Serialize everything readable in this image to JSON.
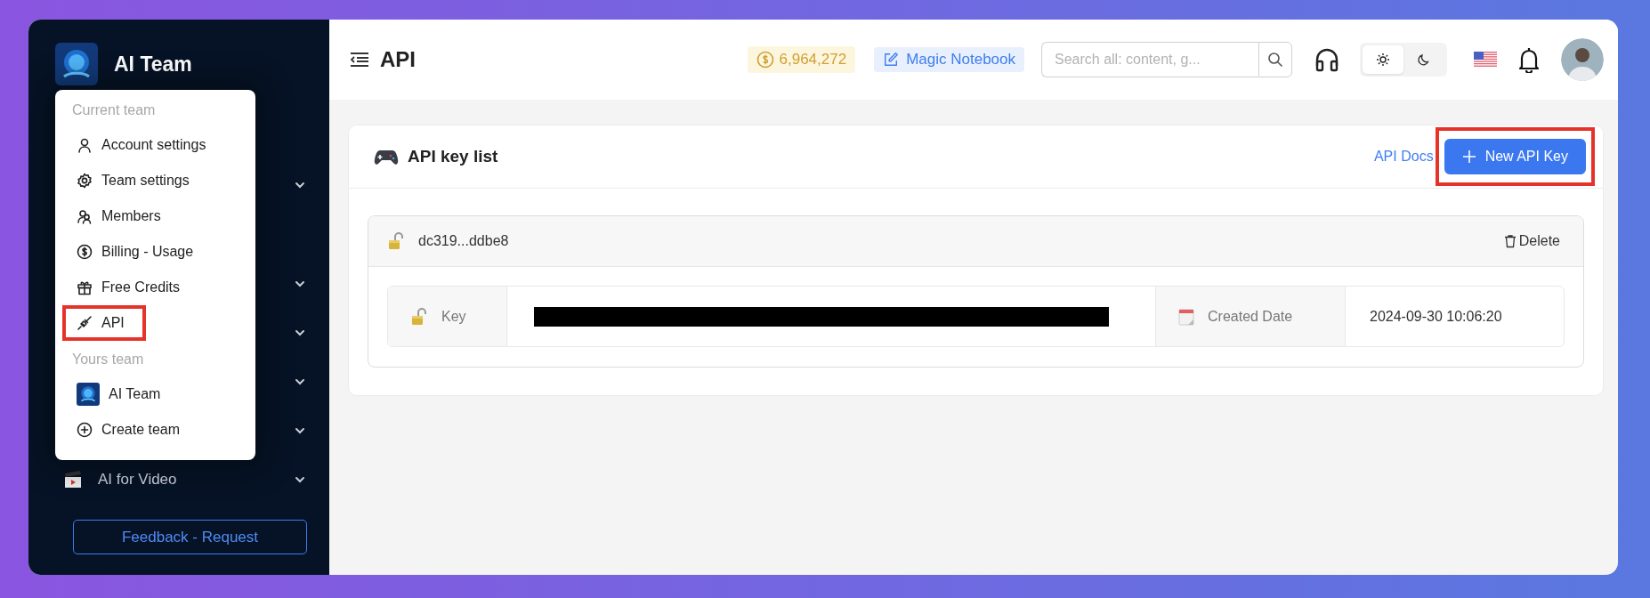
{
  "sidebar": {
    "team_name": "AI Team",
    "nav_items": [
      {
        "expanded": false
      },
      {
        "expanded": false
      },
      {
        "expanded": false
      },
      {
        "expanded": false
      },
      {
        "expanded": false
      },
      {
        "label": "AI for Video",
        "kind": "clapper",
        "expanded": false
      }
    ],
    "feedback_button": "Feedback - Request"
  },
  "team_menu": {
    "sections": [
      {
        "heading": "Current team",
        "items": [
          {
            "label": "Account settings",
            "kind": "user",
            "highlighted": false
          },
          {
            "label": "Team settings",
            "kind": "gear",
            "highlighted": false
          },
          {
            "label": "Members",
            "kind": "users",
            "highlighted": false
          },
          {
            "label": "Billing - Usage",
            "kind": "dollar",
            "highlighted": false
          },
          {
            "label": "Free Credits",
            "kind": "gift",
            "highlighted": false
          },
          {
            "label": "API",
            "kind": "plug",
            "highlighted": true
          }
        ]
      },
      {
        "heading": "Yours team",
        "items": [
          {
            "label": "AI Team",
            "kind": "team",
            "highlighted": false
          },
          {
            "label": "Create team",
            "kind": "plus",
            "highlighted": false
          }
        ]
      }
    ]
  },
  "header": {
    "title": "API",
    "credits": "6,964,272",
    "notebook_button": "Magic Notebook",
    "search": {
      "placeholder": "Search all: content, g..."
    },
    "theme": [
      {
        "kind": "light",
        "selected": true
      },
      {
        "kind": "dark",
        "selected": false
      }
    ]
  },
  "api_card": {
    "title": "API key list",
    "docs_link": "API Docs",
    "new_button": {
      "label": "New API Key",
      "highlighted": true
    },
    "keys": [
      {
        "name": "dc319...ddbe8",
        "delete_label": "Delete",
        "key_label": "Key",
        "key_redacted": true,
        "created_label": "Created Date",
        "created": "2024-09-30 10:06:20"
      }
    ]
  }
}
